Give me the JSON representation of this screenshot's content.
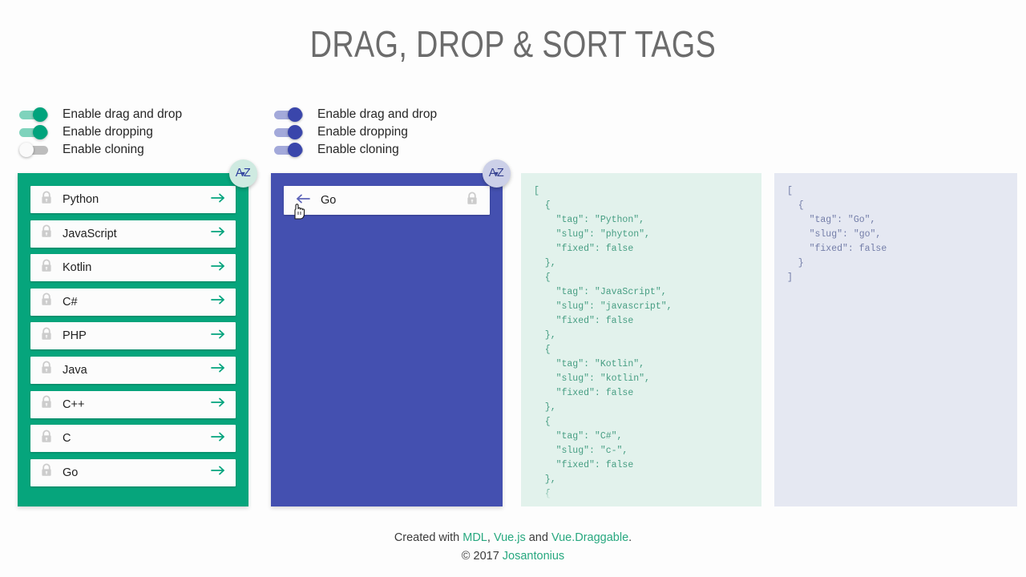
{
  "page": {
    "title": "DRAG, DROP & SORT TAGS",
    "colors": {
      "source_panel": "#06a57c",
      "target_panel": "#4450b0",
      "source_json_bg": "#e2f2ec",
      "source_json_text": "#479e83",
      "target_json_bg": "#e5e8f2",
      "target_json_text": "#737da8",
      "link": "#27a87f",
      "title_text": "#6b6b6b"
    }
  },
  "switches": {
    "source": {
      "accent": "#00a37c",
      "items": [
        {
          "label": "Enable drag and drop",
          "state": "on"
        },
        {
          "label": "Enable dropping",
          "state": "on"
        },
        {
          "label": "Enable cloning",
          "state": "off"
        }
      ]
    },
    "target": {
      "accent": "#3a46ab",
      "items": [
        {
          "label": "Enable drag and drop",
          "state": "on"
        },
        {
          "label": "Enable dropping",
          "state": "on"
        },
        {
          "label": "Enable cloning",
          "state": "on"
        }
      ]
    }
  },
  "sort_buttons": {
    "source": {
      "label": "AZ",
      "icon": "sort-alpha-down-icon"
    },
    "target": {
      "label": "AZ",
      "icon": "sort-alpha-down-icon"
    }
  },
  "source_list": {
    "move_icon": "arrow-right-icon",
    "lock_icon": "lock-icon",
    "tags": [
      {
        "label": "Python"
      },
      {
        "label": "JavaScript"
      },
      {
        "label": "Kotlin"
      },
      {
        "label": "C#"
      },
      {
        "label": "PHP"
      },
      {
        "label": "Java"
      },
      {
        "label": "C++"
      },
      {
        "label": "C"
      },
      {
        "label": "Go"
      }
    ]
  },
  "target_list": {
    "move_icon": "arrow-left-icon",
    "lock_icon": "lock-icon",
    "tags": [
      {
        "label": "Go"
      }
    ]
  },
  "json_source": {
    "text": "[\n  {\n    \"tag\": \"Python\",\n    \"slug\": \"phyton\",\n    \"fixed\": false\n  },\n  {\n    \"tag\": \"JavaScript\",\n    \"slug\": \"javascript\",\n    \"fixed\": false\n  },\n  {\n    \"tag\": \"Kotlin\",\n    \"slug\": \"kotlin\",\n    \"fixed\": false\n  },\n  {\n    \"tag\": \"C#\",\n    \"slug\": \"c-\",\n    \"fixed\": false\n  },\n  {\n    \"tag\": \"PHP\","
  },
  "json_target": {
    "text": "[\n  {\n    \"tag\": \"Go\",\n    \"slug\": \"go\",\n    \"fixed\": false\n  }\n]"
  },
  "footer": {
    "created_prefix": "Created with ",
    "link_mdl": "MDL",
    "sep1": ", ",
    "link_vue": "Vue.js",
    "sep2": " and ",
    "link_draggable": "Vue.Draggable",
    "period": ".",
    "copyright_prefix": "© 2017 ",
    "link_author": "Josantonius"
  }
}
